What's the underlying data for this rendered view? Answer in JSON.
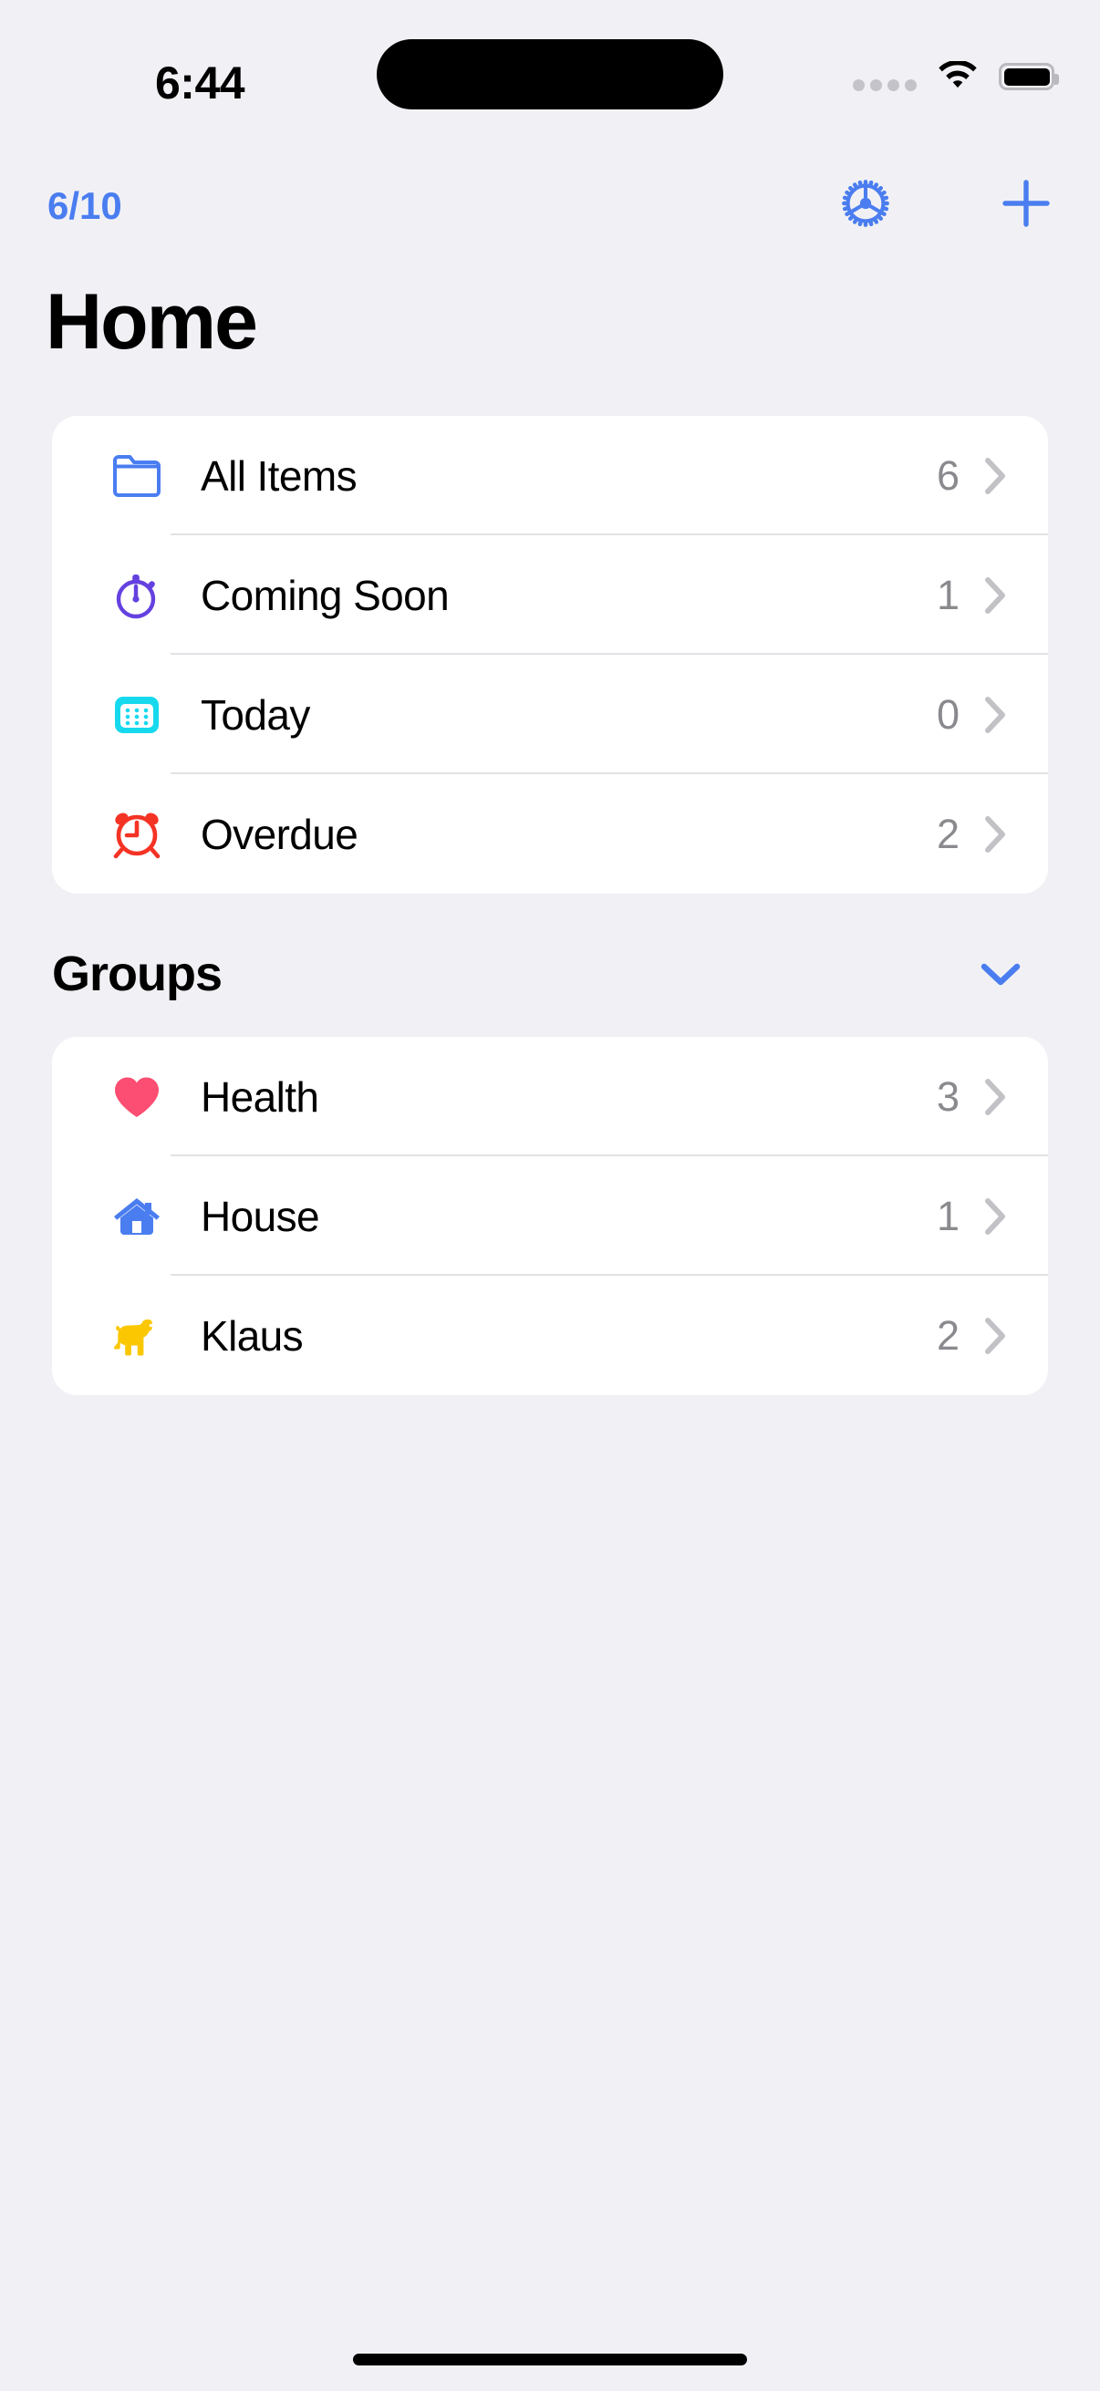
{
  "status_bar": {
    "time": "6:44",
    "signal_icon": "signal-dots-icon",
    "wifi_icon": "wifi-icon",
    "battery_icon": "battery-full-icon"
  },
  "nav_bar": {
    "left_label": "6/10",
    "settings_icon": "gear-icon",
    "add_icon": "plus-icon"
  },
  "page_title": "Home",
  "lists": {
    "rows": [
      {
        "label": "All Items",
        "count": "6",
        "icon": "folder-icon",
        "color": "#4A7DF0"
      },
      {
        "label": "Coming Soon",
        "count": "1",
        "icon": "stopwatch-icon",
        "color": "#6441E0"
      },
      {
        "label": "Today",
        "count": "0",
        "icon": "calendar-icon",
        "color": "#17D9EE"
      },
      {
        "label": "Overdue",
        "count": "2",
        "icon": "alarm-clock-icon",
        "color": "#F53325"
      }
    ]
  },
  "groups_section": {
    "title": "Groups",
    "collapse_icon": "chevron-down-icon",
    "rows": [
      {
        "label": "Health",
        "count": "3",
        "icon": "heart-icon",
        "color": "#FB4E72"
      },
      {
        "label": "House",
        "count": "1",
        "icon": "house-icon",
        "color": "#4A7DF0"
      },
      {
        "label": "Klaus",
        "count": "2",
        "icon": "dog-icon",
        "color": "#FBC700"
      }
    ]
  },
  "colors": {
    "background": "#F1F1F5",
    "card": "#FFFFFF",
    "accent_blue": "#4A7DF0",
    "count_gray": "#8A8A8E",
    "chevron_gray": "#C2C2C6",
    "separator": "#E2E2E6"
  },
  "home_indicator": "home-indicator"
}
